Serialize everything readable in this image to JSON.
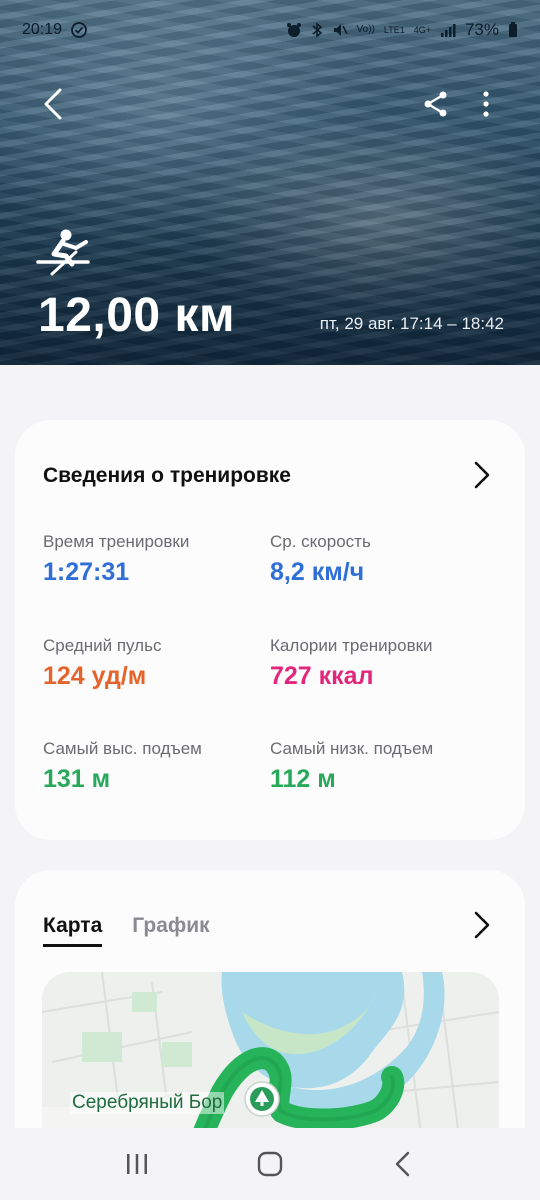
{
  "status_bar": {
    "time": "20:19",
    "battery": "73%",
    "network_labels": [
      "Vo))",
      "LTE1",
      "4G+"
    ]
  },
  "header": {
    "distance": "12,00 км",
    "date_range": "пт, 29 авг. 17:14 – 18:42",
    "activity_icon": "rowing-icon"
  },
  "summary": {
    "title": "Сведения о тренировке",
    "stats": [
      {
        "label": "Время тренировки",
        "value": "1:27:31",
        "color": "#2f6fd6"
      },
      {
        "label": "Ср. скорость",
        "value": "8,2 км/ч",
        "color": "#2f6fd6"
      },
      {
        "label": "Средний пульс",
        "value": "124 уд/м",
        "color": "#e5642b"
      },
      {
        "label": "Калории тренировки",
        "value": "727 ккал",
        "color": "#e2267b"
      },
      {
        "label": "Самый выс. подъем",
        "value": "131 м",
        "color": "#27a85a"
      },
      {
        "label": "Самый низк. подъем",
        "value": "112 м",
        "color": "#27a85a"
      }
    ]
  },
  "map_card": {
    "tabs": [
      "Карта",
      "График"
    ],
    "active_tab": "Карта",
    "map_place_label": "Серебряный Бор"
  },
  "nav": {
    "icons": [
      "recent-apps-icon",
      "home-icon",
      "back-icon"
    ]
  }
}
